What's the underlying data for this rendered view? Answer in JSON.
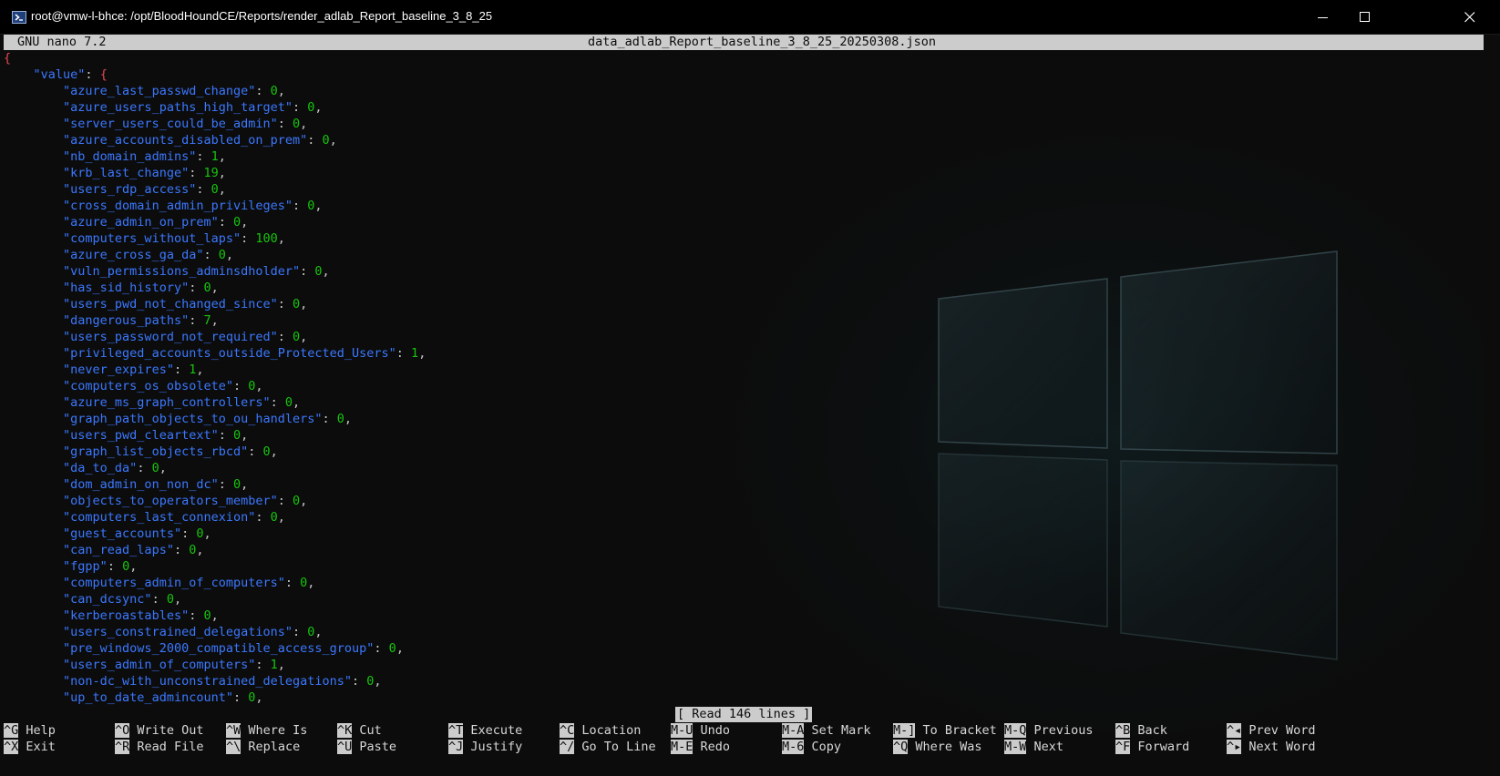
{
  "window": {
    "title": "root@vmw-l-bhce: /opt/BloodHoundCE/Reports/render_adlab_Report_baseline_3_8_25",
    "icons": [
      "powershell-icon",
      "minimize-icon",
      "maximize-icon",
      "close-icon"
    ]
  },
  "nano": {
    "version": "GNU nano 7.2",
    "filename": "data_adlab_Report_baseline_3_8_25_20250308.json",
    "status": "[ Read 146 lines ]"
  },
  "json": {
    "open_brace": "{",
    "root_key": "\"value\"",
    "root_open": "{",
    "entries": [
      {
        "key": "\"azure_last_passwd_change\"",
        "value": "0"
      },
      {
        "key": "\"azure_users_paths_high_target\"",
        "value": "0"
      },
      {
        "key": "\"server_users_could_be_admin\"",
        "value": "0"
      },
      {
        "key": "\"azure_accounts_disabled_on_prem\"",
        "value": "0"
      },
      {
        "key": "\"nb_domain_admins\"",
        "value": "1"
      },
      {
        "key": "\"krb_last_change\"",
        "value": "19"
      },
      {
        "key": "\"users_rdp_access\"",
        "value": "0"
      },
      {
        "key": "\"cross_domain_admin_privileges\"",
        "value": "0"
      },
      {
        "key": "\"azure_admin_on_prem\"",
        "value": "0"
      },
      {
        "key": "\"computers_without_laps\"",
        "value": "100"
      },
      {
        "key": "\"azure_cross_ga_da\"",
        "value": "0"
      },
      {
        "key": "\"vuln_permissions_adminsdholder\"",
        "value": "0"
      },
      {
        "key": "\"has_sid_history\"",
        "value": "0"
      },
      {
        "key": "\"users_pwd_not_changed_since\"",
        "value": "0"
      },
      {
        "key": "\"dangerous_paths\"",
        "value": "7"
      },
      {
        "key": "\"users_password_not_required\"",
        "value": "0"
      },
      {
        "key": "\"privileged_accounts_outside_Protected_Users\"",
        "value": "1"
      },
      {
        "key": "\"never_expires\"",
        "value": "1"
      },
      {
        "key": "\"computers_os_obsolete\"",
        "value": "0"
      },
      {
        "key": "\"azure_ms_graph_controllers\"",
        "value": "0"
      },
      {
        "key": "\"graph_path_objects_to_ou_handlers\"",
        "value": "0"
      },
      {
        "key": "\"users_pwd_cleartext\"",
        "value": "0"
      },
      {
        "key": "\"graph_list_objects_rbcd\"",
        "value": "0"
      },
      {
        "key": "\"da_to_da\"",
        "value": "0"
      },
      {
        "key": "\"dom_admin_on_non_dc\"",
        "value": "0"
      },
      {
        "key": "\"objects_to_operators_member\"",
        "value": "0"
      },
      {
        "key": "\"computers_last_connexion\"",
        "value": "0"
      },
      {
        "key": "\"guest_accounts\"",
        "value": "0"
      },
      {
        "key": "\"can_read_laps\"",
        "value": "0"
      },
      {
        "key": "\"fgpp\"",
        "value": "0"
      },
      {
        "key": "\"computers_admin_of_computers\"",
        "value": "0"
      },
      {
        "key": "\"can_dcsync\"",
        "value": "0"
      },
      {
        "key": "\"kerberoastables\"",
        "value": "0"
      },
      {
        "key": "\"users_constrained_delegations\"",
        "value": "0"
      },
      {
        "key": "\"pre_windows_2000_compatible_access_group\"",
        "value": "0"
      },
      {
        "key": "\"users_admin_of_computers\"",
        "value": "1"
      },
      {
        "key": "\"non-dc_with_unconstrained_delegations\"",
        "value": "0"
      },
      {
        "key": "\"up_to_date_admincount\"",
        "value": "0"
      }
    ]
  },
  "shortcuts": [
    {
      "key": "^G",
      "label": "Help"
    },
    {
      "key": "^X",
      "label": "Exit"
    },
    {
      "key": "^O",
      "label": "Write Out"
    },
    {
      "key": "^R",
      "label": "Read File"
    },
    {
      "key": "^W",
      "label": "Where Is"
    },
    {
      "key": "^\\",
      "label": "Replace"
    },
    {
      "key": "^K",
      "label": "Cut"
    },
    {
      "key": "^U",
      "label": "Paste"
    },
    {
      "key": "^T",
      "label": "Execute"
    },
    {
      "key": "^J",
      "label": "Justify"
    },
    {
      "key": "^C",
      "label": "Location"
    },
    {
      "key": "^/",
      "label": "Go To Line"
    },
    {
      "key": "M-U",
      "label": "Undo"
    },
    {
      "key": "M-E",
      "label": "Redo"
    },
    {
      "key": "M-A",
      "label": "Set Mark"
    },
    {
      "key": "M-6",
      "label": "Copy"
    },
    {
      "key": "M-]",
      "label": "To Bracket"
    },
    {
      "key": "^Q",
      "label": "Where Was"
    },
    {
      "key": "M-Q",
      "label": "Previous"
    },
    {
      "key": "M-W",
      "label": "Next"
    },
    {
      "key": "^B",
      "label": "Back"
    },
    {
      "key": "^F",
      "label": "Forward"
    },
    {
      "key": "^◂",
      "label": "Prev Word"
    },
    {
      "key": "^▸",
      "label": "Next Word"
    }
  ],
  "colors": {
    "json_key": "#3b78ff",
    "json_number": "#16c60c",
    "json_brace": "#e74856",
    "nano_bar": "#cccccc"
  }
}
